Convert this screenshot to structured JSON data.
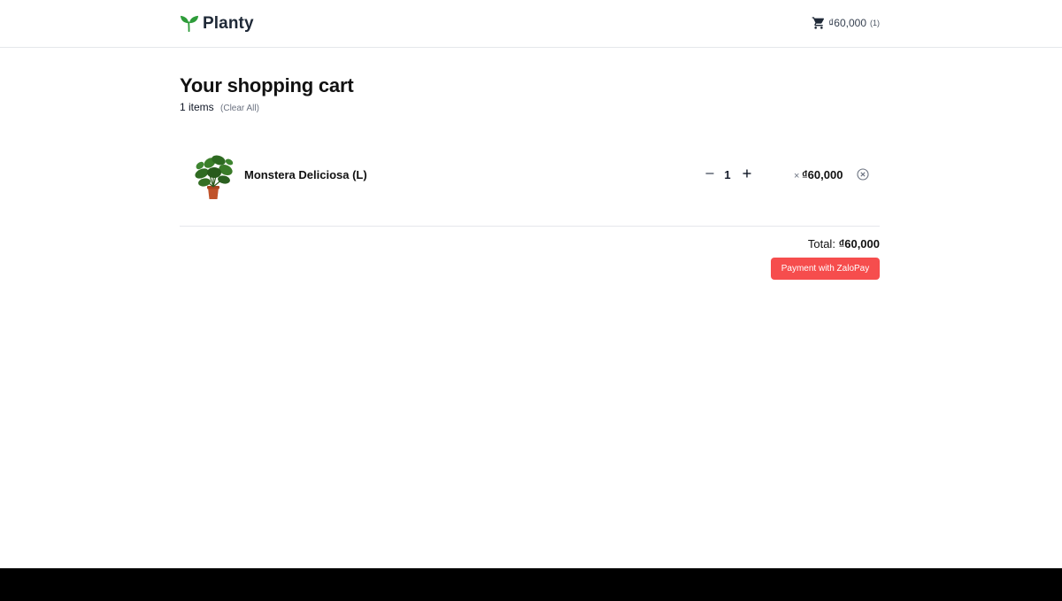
{
  "header": {
    "brand_name": "Planty",
    "cart_total": "₫60,000",
    "cart_count": "(1)",
    "brand_icon": "leaf-icon",
    "cart_icon": "cart-icon"
  },
  "cart": {
    "title": "Your shopping cart",
    "item_count": "1 items",
    "clear_all": "(Clear All)",
    "items": [
      {
        "name": "Monstera Deliciosa (L)",
        "quantity": "1",
        "times": "×",
        "price": "₫60,000"
      }
    ],
    "total_label": "Total:",
    "total_value": "₫60,000",
    "pay_button": "Payment with ZaloPay"
  },
  "colors": {
    "brand_green": "#2e9c3a",
    "pay_button": "#f64d4d"
  }
}
